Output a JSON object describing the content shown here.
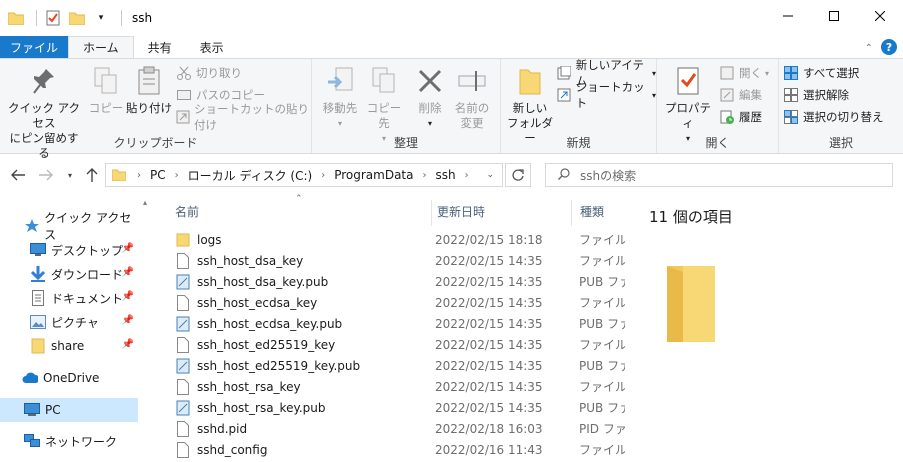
{
  "window": {
    "title": "ssh"
  },
  "tabs": [
    {
      "label": "ファイル"
    },
    {
      "label": "ホーム"
    },
    {
      "label": "共有"
    },
    {
      "label": "表示"
    }
  ],
  "ribbon": {
    "clipboard": {
      "group_label": "クリップボード",
      "pin_label_1": "クイック アクセス",
      "pin_label_2": "にピン留めする",
      "copy_label": "コピー",
      "paste_label": "貼り付け",
      "cut_label": "切り取り",
      "copy_path_label": "パスのコピー",
      "paste_shortcut_label": "ショートカットの貼り付け"
    },
    "organize": {
      "group_label": "整理",
      "move_to_label": "移動先",
      "copy_to_label": "コピー先",
      "delete_label": "削除",
      "rename_label_1": "名前の",
      "rename_label_2": "変更"
    },
    "new": {
      "group_label": "新規",
      "new_folder_label_1": "新しい",
      "new_folder_label_2": "フォルダー",
      "new_item_label": "新しいアイテム",
      "shortcut_label": "ショートカット"
    },
    "open": {
      "group_label": "開く",
      "properties_label": "プロパティ",
      "open_label": "開く",
      "edit_label": "編集",
      "history_label": "履歴"
    },
    "select": {
      "group_label": "選択",
      "select_all_label": "すべて選択",
      "select_none_label": "選択解除",
      "invert_label": "選択の切り替え"
    }
  },
  "address": {
    "segments": [
      "PC",
      "ローカル ディスク (C:)",
      "ProgramData",
      "ssh"
    ],
    "search_placeholder": "sshの検索"
  },
  "navpane": {
    "items": [
      {
        "label": "クイック アクセス",
        "icon": "star-icon",
        "pinned": false
      },
      {
        "label": "デスクトップ",
        "icon": "desktop-icon",
        "pinned": true
      },
      {
        "label": "ダウンロード",
        "icon": "download-icon",
        "pinned": true
      },
      {
        "label": "ドキュメント",
        "icon": "document-icon",
        "pinned": true
      },
      {
        "label": "ピクチャ",
        "icon": "picture-icon",
        "pinned": true
      },
      {
        "label": "share",
        "icon": "folder-icon",
        "pinned": true
      },
      {
        "label": "OneDrive",
        "icon": "cloud-icon",
        "pinned": false
      },
      {
        "label": "PC",
        "icon": "pc-icon",
        "pinned": false
      },
      {
        "label": "ネットワーク",
        "icon": "network-icon",
        "pinned": false
      }
    ]
  },
  "list": {
    "columns": {
      "name": "名前",
      "date": "更新日時",
      "type": "種類"
    },
    "rows": [
      {
        "name": "logs",
        "date": "2022/02/15 18:18",
        "type": "ファイル フ",
        "kind": "folder"
      },
      {
        "name": "ssh_host_dsa_key",
        "date": "2022/02/15 14:35",
        "type": "ファイル",
        "kind": "file"
      },
      {
        "name": "ssh_host_dsa_key.pub",
        "date": "2022/02/15 14:35",
        "type": "PUB ファ",
        "kind": "pub"
      },
      {
        "name": "ssh_host_ecdsa_key",
        "date": "2022/02/15 14:35",
        "type": "ファイル",
        "kind": "file"
      },
      {
        "name": "ssh_host_ecdsa_key.pub",
        "date": "2022/02/15 14:35",
        "type": "PUB ファ",
        "kind": "pub"
      },
      {
        "name": "ssh_host_ed25519_key",
        "date": "2022/02/15 14:35",
        "type": "ファイル",
        "kind": "file"
      },
      {
        "name": "ssh_host_ed25519_key.pub",
        "date": "2022/02/15 14:35",
        "type": "PUB ファ",
        "kind": "pub"
      },
      {
        "name": "ssh_host_rsa_key",
        "date": "2022/02/15 14:35",
        "type": "ファイル",
        "kind": "file"
      },
      {
        "name": "ssh_host_rsa_key.pub",
        "date": "2022/02/15 14:35",
        "type": "PUB ファ",
        "kind": "pub"
      },
      {
        "name": "sshd.pid",
        "date": "2022/02/18 16:03",
        "type": "PID ファイ",
        "kind": "file"
      },
      {
        "name": "sshd_config",
        "date": "2022/02/16 11:43",
        "type": "ファイル",
        "kind": "file"
      }
    ]
  },
  "details": {
    "count": "11 個の項目"
  },
  "colors": {
    "accent": "#1979ca",
    "folder": "#f8d775",
    "selection": "#cce8ff"
  }
}
